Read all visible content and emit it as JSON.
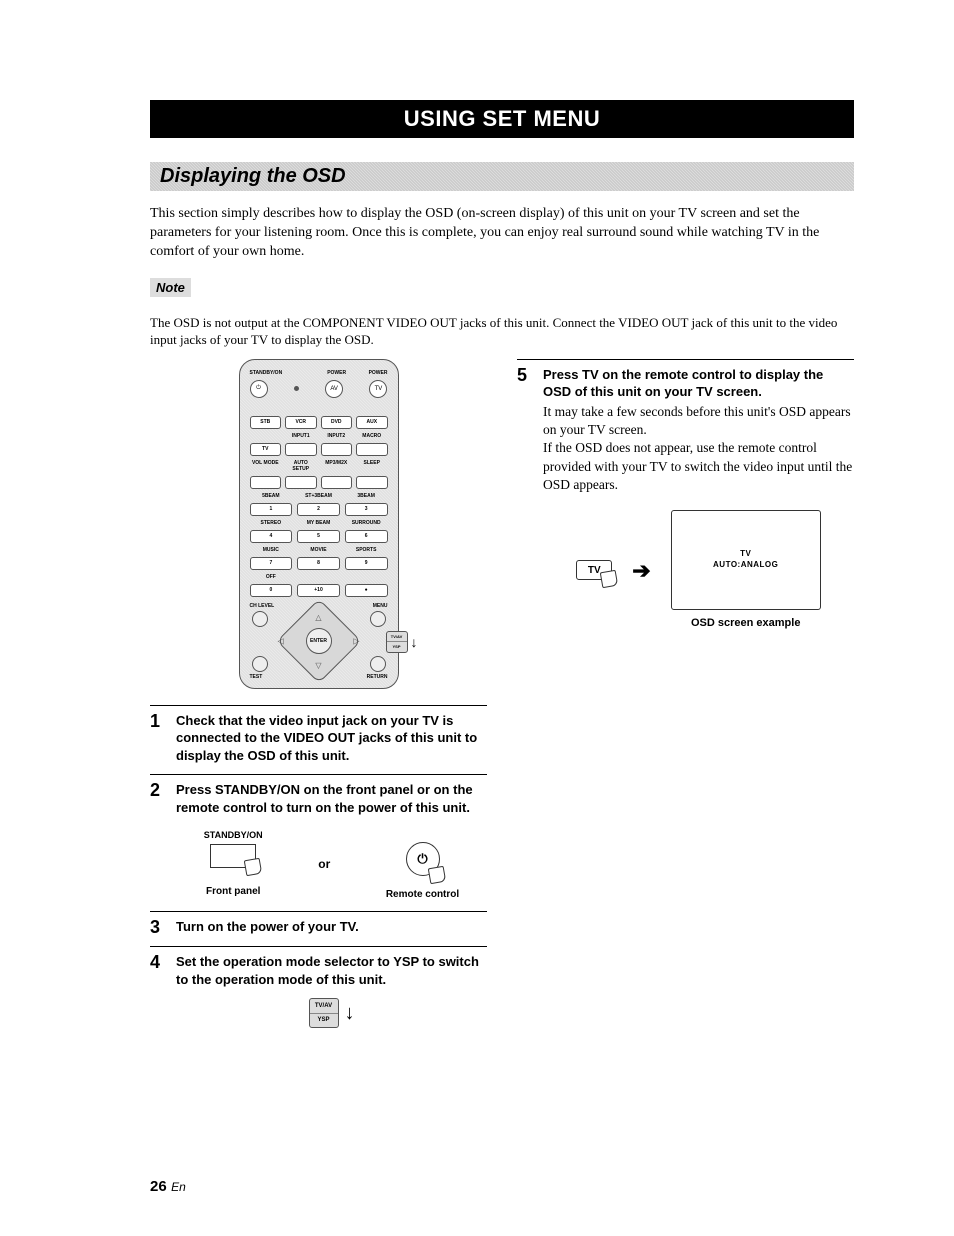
{
  "title_bar": "USING SET MENU",
  "section_heading": "Displaying the OSD",
  "intro": "This section simply describes how to display the OSD (on-screen display) of this unit on your TV screen and set the parameters for your listening room. Once this is complete, you can enjoy real surround sound while watching TV in the comfort of your own home.",
  "note_label": "Note",
  "note_text": "The OSD is not output at the COMPONENT VIDEO OUT jacks of this unit. Connect the VIDEO OUT jack of this unit to the video input jacks of your TV to display the OSD.",
  "remote": {
    "top_labels": {
      "standby": "STANDBY/ON",
      "power1": "POWER",
      "power2": "POWER"
    },
    "top_buttons": {
      "standby_glyph": "⏻",
      "av": "AV",
      "tv": "TV"
    },
    "input_row1": [
      "STB",
      "VCR",
      "DVD",
      "AUX"
    ],
    "input_row2_labels": [
      "",
      "INPUT1",
      "INPUT2",
      "MACRO"
    ],
    "input_row2": [
      "TV",
      "",
      "",
      ""
    ],
    "mode_labels": [
      "VOL MODE",
      "AUTO SETUP",
      "MP3/M2X",
      "SLEEP"
    ],
    "beam_labels": [
      "5BEAM",
      "ST+3BEAM",
      "3BEAM"
    ],
    "numpad_row1": [
      "1",
      "2",
      "3"
    ],
    "beam_labels2": [
      "STEREO",
      "MY BEAM",
      "SURROUND"
    ],
    "numpad_row2": [
      "4",
      "5",
      "6"
    ],
    "genre_labels": [
      "MUSIC",
      "MOVIE",
      "SPORTS"
    ],
    "numpad_row3": [
      "7",
      "8",
      "9"
    ],
    "bottom_row_labels": [
      "OFF",
      "",
      ""
    ],
    "numpad_row4": [
      "0",
      "+10",
      "●"
    ],
    "nav": {
      "ch_level": "CH LEVEL",
      "menu": "MENU",
      "test": "TEST",
      "return": "RETURN",
      "enter": "ENTER"
    },
    "switch": {
      "top": "TV/AV",
      "bottom": "YSP"
    }
  },
  "steps": {
    "s1": {
      "num": "1",
      "bold": "Check that the video input jack on your TV is connected to the VIDEO OUT jacks of this unit to display the OSD of this unit."
    },
    "s2": {
      "num": "2",
      "bold": "Press STANDBY/ON on the front panel or on the remote control to turn on the power of this unit.",
      "front_panel_top": "STANDBY/ON",
      "front_panel_bottom": "Front panel",
      "or": "or",
      "power_glyph": "⏻",
      "remote_bottom": "Remote control"
    },
    "s3": {
      "num": "3",
      "bold": "Turn on the power of your TV."
    },
    "s4": {
      "num": "4",
      "bold": "Set the operation mode selector to YSP to switch to the operation mode of this unit.",
      "switch_top": "TV/AV",
      "switch_bottom": "YSP",
      "arrow": "↓"
    },
    "s5": {
      "num": "5",
      "bold": "Press TV on the remote control to display the OSD of this unit on your TV screen.",
      "sub": "It may take a few seconds before this unit's OSD appears on your TV screen.\nIf the OSD does not appear, use the remote control provided with your TV to switch the video input until the OSD appears.",
      "tv_button": "TV",
      "arrow": "➔",
      "osd_line1": "TV",
      "osd_line2": "AUTO:ANALOG",
      "caption": "OSD screen example"
    }
  },
  "page_number": {
    "num": "26",
    "lang": "En"
  }
}
